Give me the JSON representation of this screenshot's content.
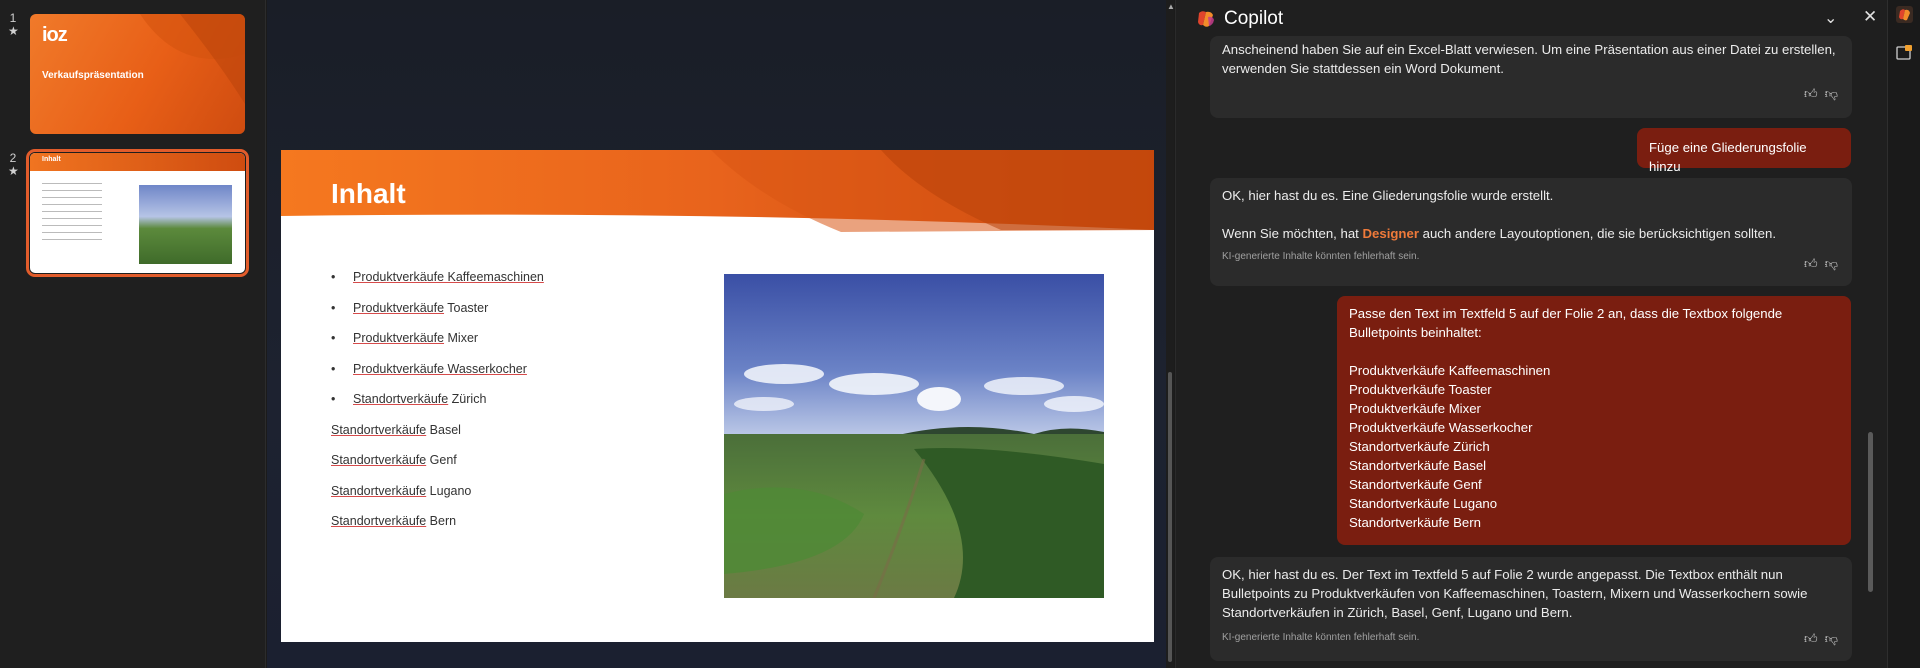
{
  "thumbnails": [
    {
      "number": "1",
      "marker": "★",
      "logo": "ioz",
      "title": "Verkaufspräsentation"
    },
    {
      "number": "2",
      "marker": "★",
      "title": "Inhalt"
    }
  ],
  "slide": {
    "title": "Inhalt",
    "items": [
      {
        "bullet": true,
        "underlined": "Produktverkäufe Kaffeemaschinen",
        "rest": ""
      },
      {
        "bullet": true,
        "underlined": "Produktverkäufe",
        "rest": " Toaster"
      },
      {
        "bullet": true,
        "underlined": "Produktverkäufe",
        "rest": " Mixer"
      },
      {
        "bullet": true,
        "underlined": "Produktverkäufe Wasserkocher",
        "rest": ""
      },
      {
        "bullet": true,
        "underlined": "Standortverkäufe",
        "rest": " Zürich"
      },
      {
        "bullet": false,
        "underlined": "Standortverkäufe",
        "rest": " Basel"
      },
      {
        "bullet": false,
        "underlined": "Standortverkäufe",
        "rest": " Genf"
      },
      {
        "bullet": false,
        "underlined": "Standortverkäufe",
        "rest": " Lugano"
      },
      {
        "bullet": false,
        "underlined": "Standortverkäufe",
        "rest": " Bern"
      }
    ],
    "bullet_char": "•"
  },
  "copilot": {
    "title": "Copilot",
    "messages": {
      "ai0_line1": "Anscheinend haben Sie auf ein Excel-Blatt verwiesen. Um eine Präsentation aus einer Datei zu erstellen,",
      "ai0_line2": "verwenden Sie stattdessen ein Word Dokument.",
      "user1": "Füge eine Gliederungsfolie hinzu",
      "ai1_line1": "OK, hier hast du es. Eine Gliederungsfolie wurde erstellt.",
      "ai1_line2_pre": "Wenn Sie möchten, hat ",
      "ai1_link": "Designer",
      "ai1_line2_post": " auch andere Layoutoptionen, die sie berücksichtigen sollten.",
      "disclaimer": "KI-generierte Inhalte könnten fehlerhaft sein.",
      "user2_lines": [
        "Passe den Text im Textfeld 5 auf der Folie 2 an, dass die Textbox folgende",
        "Bulletpoints beinhaltet:",
        "",
        "Produktverkäufe Kaffeemaschinen",
        "Produktverkäufe Toaster",
        "Produktverkäufe Mixer",
        "Produktverkäufe Wasserkocher",
        "Standortverkäufe Zürich",
        "Standortverkäufe Basel",
        "Standortverkäufe Genf",
        "Standortverkäufe Lugano",
        "Standortverkäufe Bern"
      ],
      "ai2_lines": [
        "OK, hier hast du es. Der Text im Textfeld 5 auf Folie 2 wurde angepasst. Die Textbox enthält nun",
        "Bulletpoints zu Produktverkäufen von Kaffeemaschinen, Toastern, Mixern und Wasserkochern sowie",
        "Standortverkäufen in Zürich, Basel, Genf, Lugano und Bern."
      ]
    },
    "icons": {
      "like": "thumbs-up-icon",
      "dislike": "thumbs-down-icon"
    }
  },
  "colors": {
    "accent": "#e8631c",
    "user_bubble": "#7a1e10",
    "designer_link": "#ef7a3a"
  }
}
